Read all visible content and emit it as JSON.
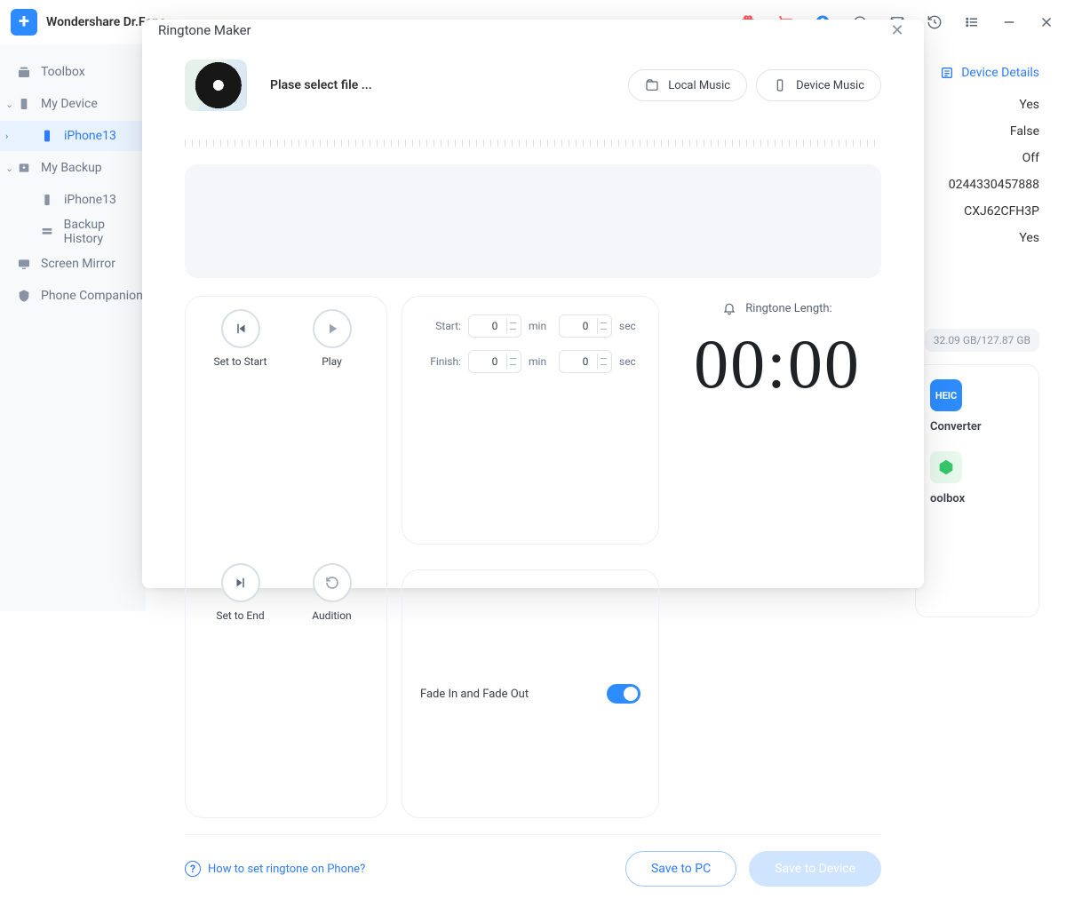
{
  "app": {
    "title": "Wondershare Dr.Fone"
  },
  "sidebar": {
    "items": [
      {
        "label": "Toolbox"
      },
      {
        "label": "My Device"
      },
      {
        "label": "iPhone13"
      },
      {
        "label": "My Backup"
      },
      {
        "label": "iPhone13"
      },
      {
        "label": "Backup History"
      },
      {
        "label": "Screen Mirror"
      },
      {
        "label": "Phone Companion"
      }
    ]
  },
  "background": {
    "device_details_label": "Device Details",
    "info": [
      "Yes",
      "False",
      "Off",
      "0244330457888",
      "CXJ62CFH3P",
      "Yes"
    ],
    "storage": "32.09 GB/127.87 GB",
    "apps": [
      {
        "label": "Converter"
      },
      {
        "label": "oolbox"
      }
    ]
  },
  "modal": {
    "title": "Ringtone Maker",
    "select_file": "Plase select file ...",
    "buttons": {
      "local": "Local Music",
      "device": "Device Music"
    },
    "controls": {
      "set_start": "Set to Start",
      "play": "Play",
      "set_end": "Set to End",
      "audition": "Audition"
    },
    "time": {
      "start_label": "Start:",
      "finish_label": "Finish:",
      "start_min": "0",
      "start_sec": "0",
      "finish_min": "0",
      "finish_sec": "0",
      "unit_min": "min",
      "unit_sec": "sec"
    },
    "fade_label": "Fade In and Fade Out",
    "length_title": "Ringtone Length:",
    "length_value": "00:00",
    "help_link": "How to set ringtone on Phone?",
    "footer": {
      "save_pc": "Save to PC",
      "save_device": "Save to Device"
    }
  }
}
